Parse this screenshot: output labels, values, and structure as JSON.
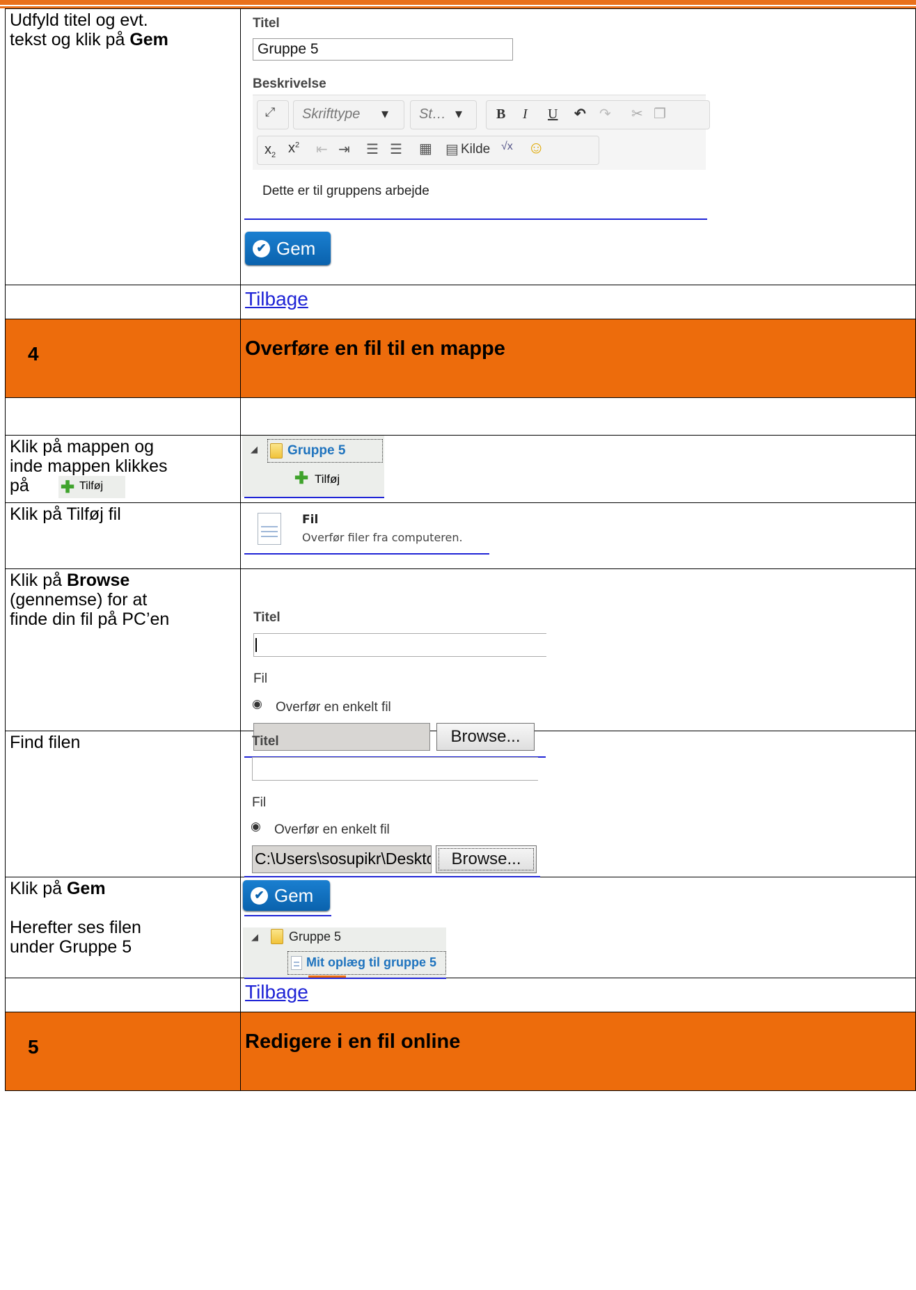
{
  "colors": {
    "accent": "#ed6c0c",
    "link": "#1f24d6",
    "button": "#0a62ad"
  },
  "row1": {
    "instruction_a": "Udfyld titel og evt.",
    "instruction_b": "tekst og klik på ",
    "instruction_bold": "Gem",
    "form": {
      "title_label": "Titel",
      "title_value": "Gruppe 5",
      "desc_label": "Beskrivelse",
      "font_select": "Skrifttype",
      "size_select": "St…",
      "kilde_label": "Kilde",
      "editor_text": "Dette er til gruppens arbejde",
      "gem_label": "Gem"
    }
  },
  "back_link": "Tilbage",
  "section4": {
    "number": "4",
    "title": "Overføre en fil til en mappe"
  },
  "row_folder": {
    "instruction_a": "Klik på mappen og",
    "instruction_b": "inde mappen klikkes",
    "instruction_c": "på",
    "inline_add": "Tilføj",
    "folder_name": "Gruppe 5",
    "add_label": "Tilføj"
  },
  "row_addfile": {
    "instruction": "Klik på Tilføj fil",
    "file_title": "Fil",
    "file_desc": "Overfør filer fra computeren."
  },
  "row_browse": {
    "instruction_a": "Klik på ",
    "instruction_bold": "Browse",
    "instruction_b": "(gennemse) for at",
    "instruction_c": "finde din fil på PC’en",
    "title_label": "Titel",
    "file_label": "Fil",
    "radio_label": "Overfør en enkelt fil",
    "browse_label": "Browse..."
  },
  "row_find": {
    "instruction": "Find filen",
    "title_label": "Titel",
    "file_label": "Fil",
    "radio_label": "Overfør en enkelt fil",
    "path_value": "C:\\Users\\sosupikr\\Desktc",
    "browse_label": "Browse..."
  },
  "row_save": {
    "instruction_a": "Klik på ",
    "instruction_bold": "Gem",
    "instruction_b": "Herefter ses filen",
    "instruction_c": "under Gruppe 5",
    "gem_label": "Gem",
    "folder_name": "Gruppe 5",
    "file_name": "Mit oplæg til gruppe 5"
  },
  "section5": {
    "number": "5",
    "title": "Redigere i en fil online"
  }
}
